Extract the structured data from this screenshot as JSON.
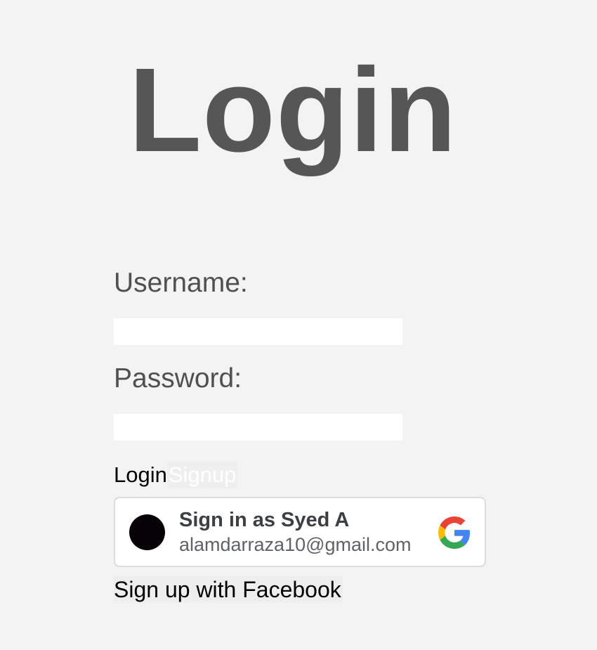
{
  "page": {
    "title": "Login"
  },
  "form": {
    "username_label": "Username:",
    "username_value": "",
    "password_label": "Password:",
    "password_value": ""
  },
  "buttons": {
    "login_label": "Login",
    "signup_label": "Signup"
  },
  "google_signin": {
    "name_text": "Sign in as Syed A",
    "email": "alamdarraza10@gmail.com",
    "icon": "google-logo-icon",
    "avatar_color": "#060206"
  },
  "facebook": {
    "label": "Sign up with Facebook"
  },
  "colors": {
    "background": "#f3f3f3",
    "title": "#565656",
    "label": "#505050"
  }
}
